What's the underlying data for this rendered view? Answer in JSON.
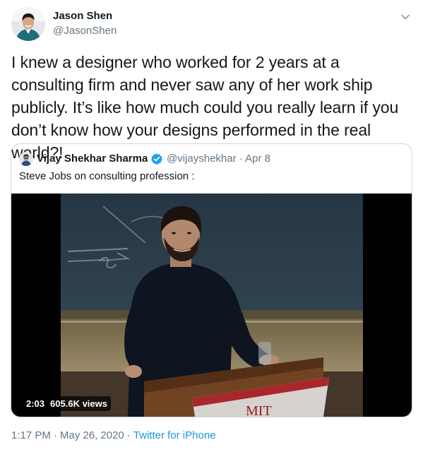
{
  "author": {
    "name": "Jason Shen",
    "handle": "@JasonShen"
  },
  "tweet": {
    "text": "I knew a designer who worked for 2 years at a consulting firm and never saw any of her work ship publicly. It’s like how much could you really learn if you don’t know how your designs performed in the real world?!"
  },
  "quoted": {
    "name": "Vijay Shekhar Sharma",
    "handle": "@vijayshekhar",
    "separator": "·",
    "date": "Apr 8",
    "text": "Steve Jobs on consulting profession :",
    "video": {
      "duration": "2:03",
      "views": "605.6K views",
      "banner_text": "MIT"
    }
  },
  "meta": {
    "time": "1:17 PM",
    "separator": "·",
    "date": "May 26, 2020",
    "source": "Twitter for iPhone"
  },
  "colors": {
    "primary_text": "#14171a",
    "secondary_text": "#657786",
    "link": "#1b95e0",
    "border": "#ccd6dd",
    "verified": "#1da1f2"
  },
  "icons": {
    "caret": "chevron-down-icon",
    "verified": "verified-badge-icon"
  }
}
